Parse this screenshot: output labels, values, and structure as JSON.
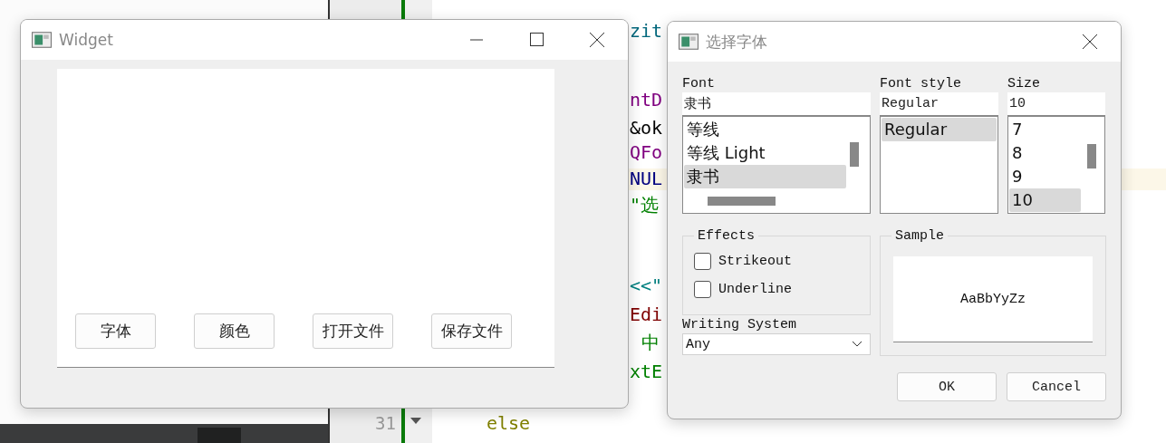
{
  "editor": {
    "line_numbers": [
      "31"
    ],
    "code_fragments": [
      {
        "text": "zit",
        "color": "#00677c"
      },
      {
        "text": "ntD",
        "color": "#800080"
      },
      {
        "text": "&ok",
        "color": "#000000"
      },
      {
        "text": "QFo",
        "color": "#800080"
      },
      {
        "text": "NUL",
        "color": "#000080"
      },
      {
        "text": "\"选",
        "color": "#008000"
      },
      {
        "text": "<<\"",
        "color": "#008080"
      },
      {
        "text": "Edi",
        "color": "#800000"
      },
      {
        "text": "中",
        "color": "#008000"
      },
      {
        "text": "xtE",
        "color": "#008000"
      },
      {
        "text": "else",
        "color": "#808000"
      }
    ]
  },
  "widget": {
    "title": "Widget",
    "buttons": [
      "字体",
      "颜色",
      "打开文件",
      "保存文件"
    ]
  },
  "font_dialog": {
    "title": "选择字体",
    "font": {
      "label": "Font",
      "value": "隶书",
      "items": [
        {
          "label": "等线",
          "selected": false
        },
        {
          "label": "等线 Light",
          "selected": false
        },
        {
          "label": "隶书",
          "selected": true
        }
      ]
    },
    "style": {
      "label": "Font style",
      "value": "Regular",
      "items": [
        {
          "label": "Regular",
          "selected": true
        }
      ]
    },
    "size": {
      "label": "Size",
      "value": "10",
      "items": [
        {
          "label": "7",
          "selected": false
        },
        {
          "label": "8",
          "selected": false
        },
        {
          "label": "9",
          "selected": false
        },
        {
          "label": "10",
          "selected": true
        }
      ]
    },
    "effects": {
      "title": "Effects",
      "options": [
        {
          "label": "Strikeout",
          "checked": false
        },
        {
          "label": "Underline",
          "checked": false
        }
      ]
    },
    "writing_system": {
      "label": "Writing System",
      "value": "Any"
    },
    "sample": {
      "title": "Sample",
      "text": "AaBbYyZz"
    },
    "buttons": [
      "OK",
      "Cancel"
    ]
  }
}
